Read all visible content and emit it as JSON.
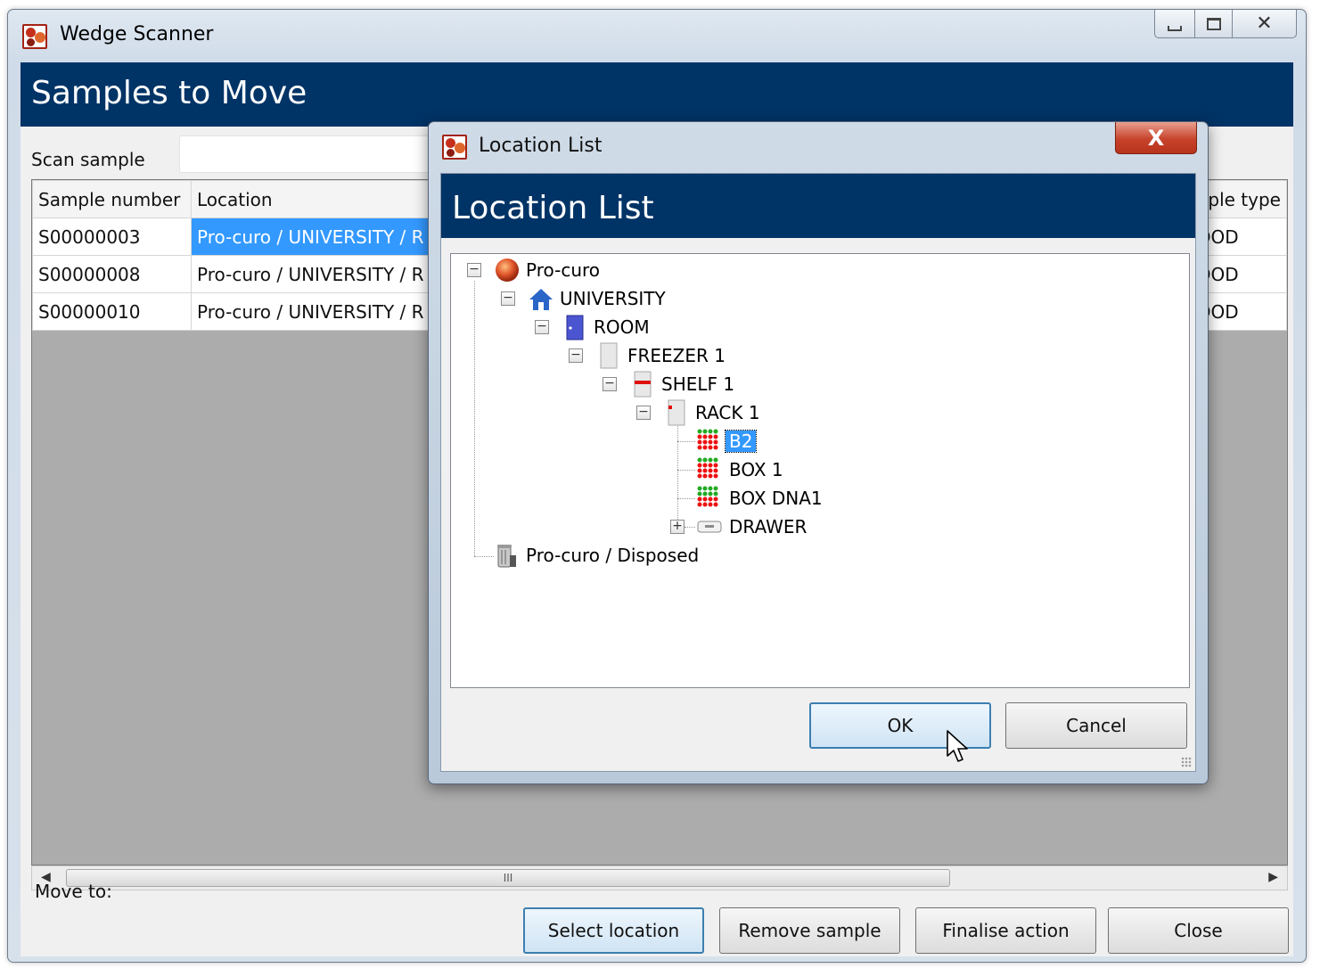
{
  "window": {
    "title": "Wedge Scanner",
    "caption_min": "minimize",
    "caption_max": "maximize",
    "caption_close": "✕"
  },
  "main": {
    "header": "Samples to Move",
    "scan_label": "Scan sample",
    "scan_value": "",
    "columns": [
      "Sample number",
      "Location",
      "nple type"
    ],
    "rows": [
      {
        "sample": "S00000003",
        "location": "Pro-curo / UNIVERSITY / R",
        "type": "OOD"
      },
      {
        "sample": "S00000008",
        "location": "Pro-curo / UNIVERSITY / R",
        "type": "OOD"
      },
      {
        "sample": "S00000010",
        "location": "Pro-curo / UNIVERSITY / R",
        "type": "OOD"
      }
    ],
    "scroll_thumb": "III",
    "move_to_label": "Move to:",
    "buttons": {
      "select_location": "Select location",
      "remove_sample": "Remove sample",
      "finalise_action": "Finalise action",
      "close": "Close"
    }
  },
  "dialog": {
    "title": "Location List",
    "header": "Location List",
    "close_glyph": "X",
    "expand_collapsed": "+",
    "expand_open": "−",
    "tree": {
      "root": "Pro-curo",
      "university": "UNIVERSITY",
      "room": "ROOM",
      "freezer": "FREEZER 1",
      "shelf": "SHELF 1",
      "rack": "RACK 1",
      "box_b2": "B2",
      "box_1": "BOX 1",
      "box_dna": "BOX DNA1",
      "drawer": "DRAWER",
      "disposed": "Pro-curo / Disposed"
    },
    "ok": "OK",
    "cancel": "Cancel"
  },
  "colors": {
    "header_bg": "#003366",
    "selection": "#3399ff",
    "well_green": "#22aa22",
    "well_red": "#ee1111"
  }
}
